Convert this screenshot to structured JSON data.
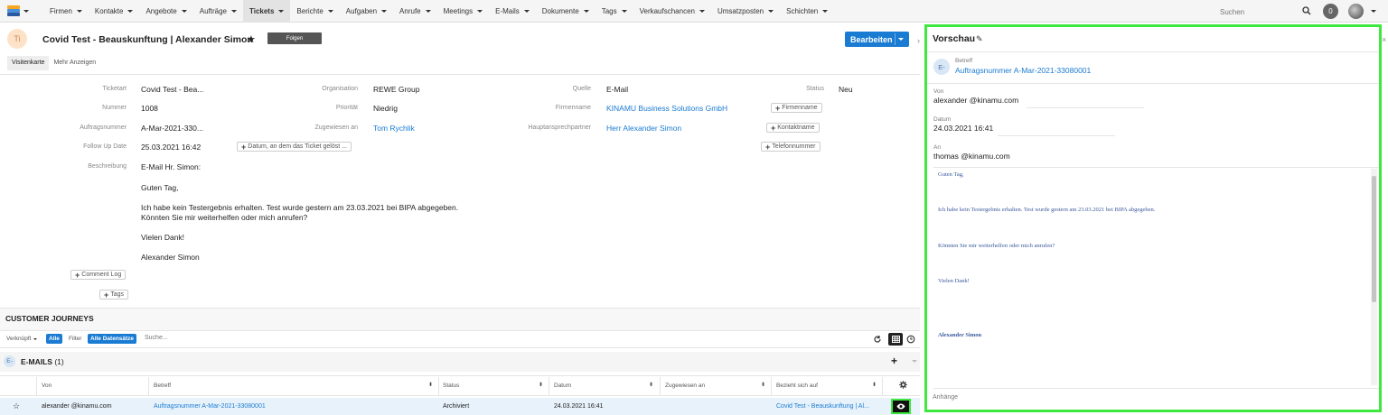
{
  "nav": {
    "items": [
      {
        "label": "Firmen",
        "caret": true
      },
      {
        "label": "Kontakte",
        "caret": true
      },
      {
        "label": "Angebote",
        "caret": true
      },
      {
        "label": "Aufträge",
        "caret": true
      },
      {
        "label": "Tickets",
        "caret": true,
        "active": true
      },
      {
        "label": "Berichte",
        "caret": true
      },
      {
        "label": "Aufgaben",
        "caret": true
      },
      {
        "label": "Anrufe",
        "caret": true
      },
      {
        "label": "Meetings",
        "caret": true
      },
      {
        "label": "E-Mails",
        "caret": true
      },
      {
        "label": "Dokumente",
        "caret": true
      },
      {
        "label": "Tags",
        "caret": true
      },
      {
        "label": "Verkaufschancen",
        "caret": true
      },
      {
        "label": "Umsatzposten",
        "caret": true
      },
      {
        "label": "Schichten",
        "caret": true
      }
    ],
    "search_placeholder": "Suchen",
    "notification_count": "0"
  },
  "record": {
    "avatar_initials": "Ti",
    "title": "Covid Test - Beauskunftung | Alexander Simon",
    "follow_label": "Folgen",
    "edit_label": "Bearbeiten"
  },
  "tabs": [
    "Visitenkarte",
    "Mehr Anzeigen"
  ],
  "fields": {
    "col1": [
      {
        "label": "Ticketart",
        "value": "Covid Test - Bea..."
      },
      {
        "label": "Nummer",
        "value": "1008"
      },
      {
        "label": "Auftragsnummer",
        "value": "A-Mar-2021-330..."
      },
      {
        "label": "Follow Up Date",
        "value": "25.03.2021 16:42"
      },
      {
        "label": "Beschreibung",
        "value": "E-Mail Hr. Simon:"
      }
    ],
    "col2": [
      {
        "label": "Organisation",
        "value": "REWE Group",
        "link": false
      },
      {
        "label": "Priorität",
        "value": "Niedrig",
        "link": false
      },
      {
        "label": "Zugewiesen an",
        "value": "Tom Rychlik",
        "link": true
      }
    ],
    "col3": [
      {
        "label": "Quelle",
        "value": "E-Mail",
        "link": false
      },
      {
        "label": "Firmenname",
        "value": "KINAMU Business Solutions GmbH",
        "link": true
      },
      {
        "label": "Hauptansprechpartner",
        "value": "Herr Alexander Simon",
        "link": true
      }
    ],
    "status_label": "Status",
    "status_value": "Neu",
    "add_date_label": "Datum, an dem das Ticket gelöst ...",
    "add_firmenname": "Firmenname",
    "add_kontaktname": "Kontaktname",
    "add_telefonnummer": "Telefonnummer",
    "add_comment_log": "Comment Log",
    "add_tags": "Tags"
  },
  "description_lines": [
    "Guten Tag,",
    "Ich habe kein Testergebnis erhalten. Test wurde gestern am 23.03.2021 bei BIPA abgegeben.",
    "Könnten Sie mir weiterhelfen oder mich anrufen?",
    "Vielen Dank!",
    "Alexander Simon"
  ],
  "journeys": {
    "title": "CUSTOMER JOURNEYS",
    "linked_label": "Verknüpft",
    "linked_value": "Alle",
    "filter_label": "Filter",
    "filter_value": "Alle Datensätze",
    "search_placeholder": "Suche..."
  },
  "emails": {
    "avatar": "E-",
    "title": "E-MAILS",
    "count": "(1)",
    "columns": [
      "Von",
      "Betreff",
      "Status",
      "Datum",
      "Zugewiesen an",
      "Bezieht sich auf"
    ],
    "rows": [
      {
        "von": "alexander @kinamu.com",
        "betreff": "Auftragsnummer A-Mar-2021-33080001",
        "status": "Archiviert",
        "datum": "24.03.2021 16:41",
        "zugewiesen": "",
        "bezieht": "Covid Test - Beauskunftung | Al..."
      }
    ]
  },
  "preview": {
    "title": "Vorschau",
    "avatar": "E-",
    "betreff_label": "Betreff",
    "betreff_value": "Auftragsnummer A-Mar-2021-33080001",
    "von_label": "Von",
    "von_value": "alexander @kinamu.com",
    "datum_label": "Datum",
    "datum_value": "24.03.2021 16:41",
    "an_label": "An",
    "an_value": "thomas @kinamu.com",
    "body": [
      "Guten Tag,",
      "Ich habe kein Testergebnis erhalten. Test wurde gestern am 23.03.2021 bei BIPA abgegeben.",
      "Könnten Sie mir weiterhelfen oder mich anrufen?",
      "Vielen Dank!",
      "Alexander Simon"
    ],
    "attachments_label": "Anhänge"
  },
  "colors": {
    "accent": "#1a7bd2",
    "highlight": "#3ee83e"
  }
}
